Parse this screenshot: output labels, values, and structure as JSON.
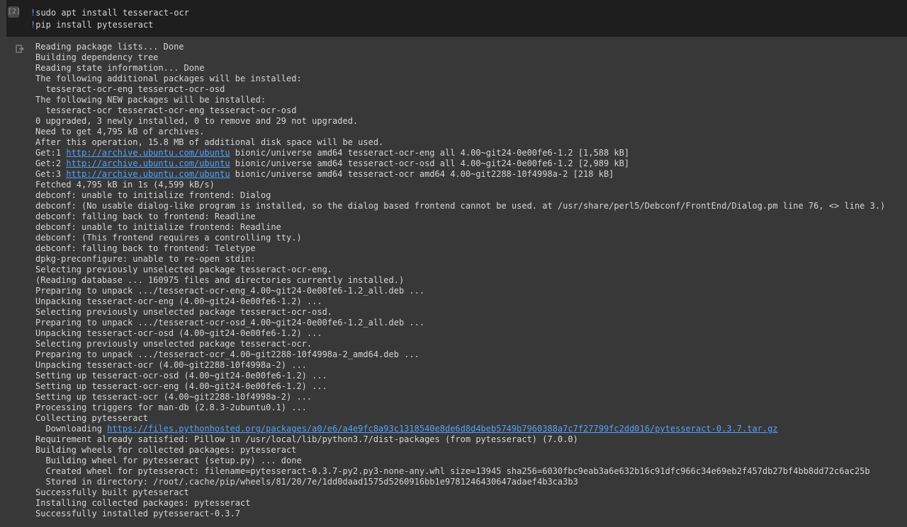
{
  "cell": {
    "exec_count": "[2]",
    "code_lines": [
      {
        "bang": "!",
        "text": "sudo apt install tesseract-ocr"
      },
      {
        "bang": "!",
        "text": "pip install pytesseract"
      }
    ]
  },
  "output_lines": [
    {
      "text": "Reading package lists... Done"
    },
    {
      "text": "Building dependency tree"
    },
    {
      "text": "Reading state information... Done"
    },
    {
      "text": "The following additional packages will be installed:"
    },
    {
      "text": "  tesseract-ocr-eng tesseract-ocr-osd"
    },
    {
      "text": "The following NEW packages will be installed:"
    },
    {
      "text": "  tesseract-ocr tesseract-ocr-eng tesseract-ocr-osd"
    },
    {
      "text": "0 upgraded, 3 newly installed, 0 to remove and 29 not upgraded."
    },
    {
      "text": "Need to get 4,795 kB of archives."
    },
    {
      "text": "After this operation, 15.8 MB of additional disk space will be used."
    },
    {
      "text": "Get:1 ",
      "link": "http://archive.ubuntu.com/ubuntu",
      "after": " bionic/universe amd64 tesseract-ocr-eng all 4.00~git24-0e00fe6-1.2 [1,588 kB]"
    },
    {
      "text": "Get:2 ",
      "link": "http://archive.ubuntu.com/ubuntu",
      "after": " bionic/universe amd64 tesseract-ocr-osd all 4.00~git24-0e00fe6-1.2 [2,989 kB]"
    },
    {
      "text": "Get:3 ",
      "link": "http://archive.ubuntu.com/ubuntu",
      "after": " bionic/universe amd64 tesseract-ocr amd64 4.00~git2288-10f4998a-2 [218 kB]"
    },
    {
      "text": "Fetched 4,795 kB in 1s (4,599 kB/s)"
    },
    {
      "text": "debconf: unable to initialize frontend: Dialog"
    },
    {
      "text": "debconf: (No usable dialog-like program is installed, so the dialog based frontend cannot be used. at /usr/share/perl5/Debconf/FrontEnd/Dialog.pm line 76, <> line 3.)"
    },
    {
      "text": "debconf: falling back to frontend: Readline"
    },
    {
      "text": "debconf: unable to initialize frontend: Readline"
    },
    {
      "text": "debconf: (This frontend requires a controlling tty.)"
    },
    {
      "text": "debconf: falling back to frontend: Teletype"
    },
    {
      "text": "dpkg-preconfigure: unable to re-open stdin:"
    },
    {
      "text": "Selecting previously unselected package tesseract-ocr-eng."
    },
    {
      "text": "(Reading database ... 160975 files and directories currently installed.)"
    },
    {
      "text": "Preparing to unpack .../tesseract-ocr-eng_4.00~git24-0e00fe6-1.2_all.deb ..."
    },
    {
      "text": "Unpacking tesseract-ocr-eng (4.00~git24-0e00fe6-1.2) ..."
    },
    {
      "text": "Selecting previously unselected package tesseract-ocr-osd."
    },
    {
      "text": "Preparing to unpack .../tesseract-ocr-osd_4.00~git24-0e00fe6-1.2_all.deb ..."
    },
    {
      "text": "Unpacking tesseract-ocr-osd (4.00~git24-0e00fe6-1.2) ..."
    },
    {
      "text": "Selecting previously unselected package tesseract-ocr."
    },
    {
      "text": "Preparing to unpack .../tesseract-ocr_4.00~git2288-10f4998a-2_amd64.deb ..."
    },
    {
      "text": "Unpacking tesseract-ocr (4.00~git2288-10f4998a-2) ..."
    },
    {
      "text": "Setting up tesseract-ocr-osd (4.00~git24-0e00fe6-1.2) ..."
    },
    {
      "text": "Setting up tesseract-ocr-eng (4.00~git24-0e00fe6-1.2) ..."
    },
    {
      "text": "Setting up tesseract-ocr (4.00~git2288-10f4998a-2) ..."
    },
    {
      "text": "Processing triggers for man-db (2.8.3-2ubuntu0.1) ..."
    },
    {
      "text": "Collecting pytesseract"
    },
    {
      "text": "  Downloading ",
      "link": "https://files.pythonhosted.org/packages/a0/e6/a4e9fc8a93c1318540e8de6d8d4beb5749b7960388a7c7f27799fc2dd016/pytesseract-0.3.7.tar.gz",
      "after": ""
    },
    {
      "text": "Requirement already satisfied: Pillow in /usr/local/lib/python3.7/dist-packages (from pytesseract) (7.0.0)"
    },
    {
      "text": "Building wheels for collected packages: pytesseract"
    },
    {
      "text": "  Building wheel for pytesseract (setup.py) ... done"
    },
    {
      "text": "  Created wheel for pytesseract: filename=pytesseract-0.3.7-py2.py3-none-any.whl size=13945 sha256=6030fbc9eab3a6e632b16c91dfc966c34e69eb2f457db27bf4bb8dd72c6ac25b"
    },
    {
      "text": "  Stored in directory: /root/.cache/pip/wheels/81/20/7e/1dd0daad1575d5260916bb1e9781246430647adaef4b3ca3b3"
    },
    {
      "text": "Successfully built pytesseract"
    },
    {
      "text": "Installing collected packages: pytesseract"
    },
    {
      "text": "Successfully installed pytesseract-0.3.7"
    }
  ]
}
